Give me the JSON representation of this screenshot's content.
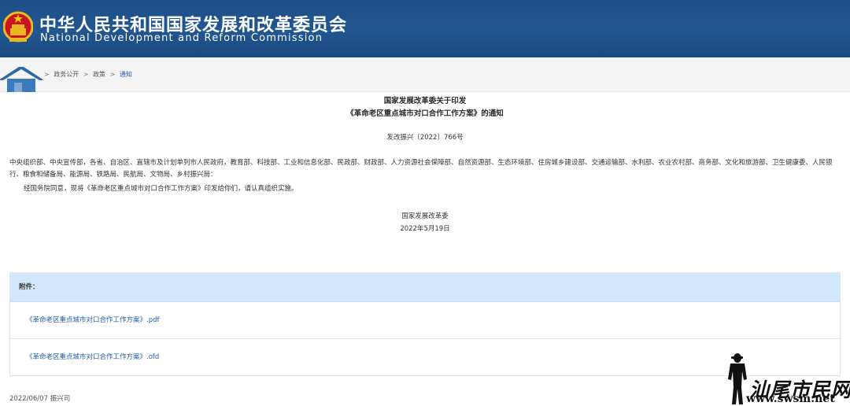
{
  "header": {
    "title_cn": "中华人民共和国国家发展和改革委员会",
    "title_en": "National Development and Reform Commission",
    "emblem_icon": "national-emblem-icon",
    "colors": {
      "header_bg": "#1d4f87",
      "accent_red": "#c8161d",
      "gold": "#e8b923"
    }
  },
  "navbar": {
    "home_icon": "home-icon",
    "breadcrumb": [
      {
        "label": "政务公开"
      },
      {
        "label": "政策"
      },
      {
        "label": "通知"
      }
    ],
    "separator": ">"
  },
  "document": {
    "title_line1": "国家发展改革委关于印发",
    "title_line2": "《革命老区重点城市对口合作工作方案》的通知",
    "doc_number": "发改振兴〔2022〕766号",
    "recipients": "中央组织部、中央宣传部，各省、自治区、直辖市及计划单列市人民政府，教育部、科技部、工业和信息化部、民政部、财政部、人力资源社会保障部、自然资源部、生态环境部、住房城乡建设部、交通运输部、水利部、农业农村部、商务部、文化和旅游部、卫生健康委、人民银行、粮食和储备局、能源局、铁路局、民航局、文物局、乡村振兴局：",
    "body": "经国务院同意，现将《革命老区重点城市对口合作工作方案》印发给你们，请认真组织实施。",
    "signer": "国家发展改革委",
    "sign_date": "2022年5月19日"
  },
  "attachments": {
    "header": "附件：",
    "items": [
      {
        "label": "《革命老区重点城市对口合作工作方案》.pdf"
      },
      {
        "label": "《革命老区重点城市对口合作工作方案》.ofd"
      }
    ]
  },
  "footer": {
    "publish_info": "2022/06/07 振兴司"
  },
  "watermark": {
    "text": "汕尾市民网",
    "url": "www.swsm.net",
    "figure_icon": "standing-person-silhouette-icon"
  }
}
